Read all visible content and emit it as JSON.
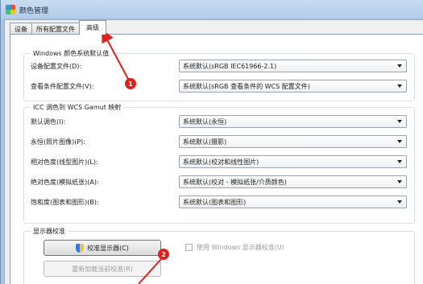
{
  "window": {
    "title": "颜色管理",
    "icon": "color-management-icon"
  },
  "tabs": [
    "设备",
    "所有配置文件",
    "高级"
  ],
  "active_tab": "高级",
  "windows_defaults": {
    "legend": "Windows 颜色系统默认值",
    "rows": [
      {
        "label": "设备配置文件(D):",
        "value": "系统默认(sRGB IEC61966-2.1)"
      },
      {
        "label": "查看条件配置文件(V):",
        "value": "系统默认(sRGB 查看条件的 WCS 配置文件)"
      }
    ]
  },
  "icc_mapping": {
    "legend": "ICC 调色到 WCS Gamut 映射",
    "rows": [
      {
        "label": "默认调色(I):",
        "value": "系统默认(永恒)"
      },
      {
        "label": "永恒(照片图像)(P):",
        "value": "系统默认(摄影)"
      },
      {
        "label": "相对色度(线型图片)(L):",
        "value": "系统默认(校对和线性图片)"
      },
      {
        "label": "绝对色度(模拟纸张)(A):",
        "value": "系统默认(校对 - 模拟纸张/介质颜色)"
      },
      {
        "label": "饱和度(图表和图形)(B):",
        "value": "系统默认(图表和图形)"
      }
    ]
  },
  "calibration": {
    "legend": "显示器校准",
    "calibrate_button": "校准显示器(C)",
    "reload_button": "重新加载当前校准(R)",
    "checkbox_label": "使用 Windows 显示器校准(U)",
    "checkbox_checked": false
  },
  "annotations": [
    {
      "number": "1"
    },
    {
      "number": "2"
    }
  ],
  "colors": {
    "annotation": "#e0201c"
  }
}
